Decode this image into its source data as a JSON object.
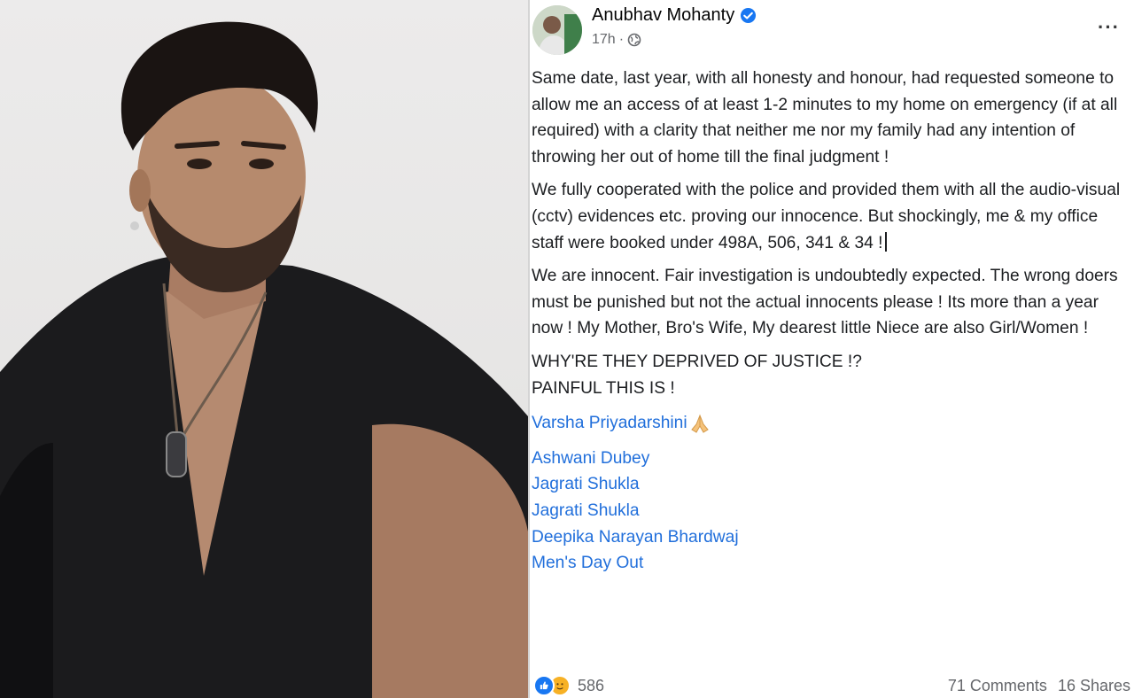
{
  "post": {
    "author": "Anubhav Mohanty",
    "time": "17h",
    "separator": "·",
    "more_label": "···",
    "paragraphs": [
      "Same date, last year, with all honesty and honour, had requested someone to allow me an access of at least 1-2 minutes to my home on emergency (if at all required) with a clarity that neither me nor my family had any intention of throwing her out of home till the final judgment !",
      "We fully cooperated with the police and provided them with all the audio-visual (cctv) evidences etc. proving our innocence. But shockingly, me & my office staff were booked under 498A, 506, 341 & 34 !",
      "We are innocent. Fair investigation is undoubtedly expected. The wrong doers must be punished but not the actual innocents please ! Its more than a year now ! My Mother, Bro's Wife, My dearest little Niece are also Girl/Women !"
    ],
    "shout_line_1": "WHY'RE THEY DEPRIVED OF JUSTICE !?",
    "shout_line_2": "PAINFUL THIS IS !",
    "tags": {
      "first": "Varsha Priyadarshini",
      "rest": [
        "Ashwani Dubey",
        "Jagrati Shukla",
        "Jagrati Shukla",
        "Deepika Narayan Bhardwaj",
        "Men's Day Out"
      ]
    },
    "reactions_count": "586",
    "comments": "71 Comments",
    "shares": "16 Shares"
  },
  "colors": {
    "link": "#216fdb",
    "like": "#1877f2",
    "care": "#f7b125",
    "verified": "#1877f2"
  },
  "icons": [
    "verified-badge-icon",
    "globe-icon",
    "more-options-icon",
    "folded-hands-emoji",
    "like-reaction-icon",
    "care-reaction-icon"
  ]
}
